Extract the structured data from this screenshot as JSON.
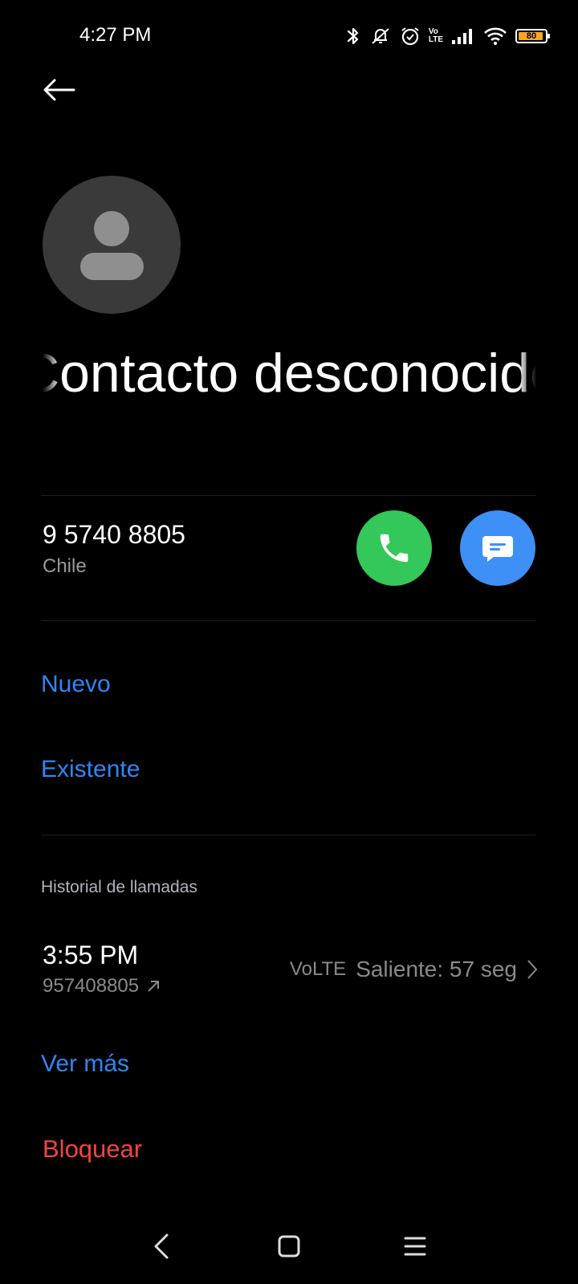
{
  "status_bar": {
    "time": "4:27 PM",
    "icons": [
      "bluetooth-icon",
      "mute-icon",
      "alarm-icon",
      "volte-icon",
      "signal-icon",
      "wifi-icon",
      "battery-icon"
    ],
    "volte_label_top": "Vo",
    "volte_label_bottom": "LTE",
    "battery_level": "80"
  },
  "header": {
    "back_icon": "back-arrow-icon"
  },
  "contact": {
    "name": "Contacto desconocido",
    "phone_number": "9 5740 8805",
    "country": "Chile",
    "call_icon": "phone-icon",
    "message_icon": "message-icon"
  },
  "add_contact": {
    "new_label": "Nuevo",
    "existing_label": "Existente"
  },
  "call_history": {
    "title": "Historial de llamadas",
    "entries": [
      {
        "time": "3:55 PM",
        "number": "957408805",
        "direction_icon": "outgoing-arrow-icon",
        "network": "VoLTE",
        "status": "Saliente: 57 seg"
      }
    ],
    "see_more_label": "Ver más"
  },
  "block_label": "Bloquear",
  "colors": {
    "background": "#000000",
    "link_blue": "#2f86f5",
    "block_red": "#f2453d",
    "call_green": "#34c759",
    "message_blue": "#3e90f7",
    "battery_orange": "#f5a623"
  },
  "nav_bar": {
    "icons": [
      "nav-back-icon",
      "nav-home-icon",
      "nav-menu-icon"
    ]
  }
}
